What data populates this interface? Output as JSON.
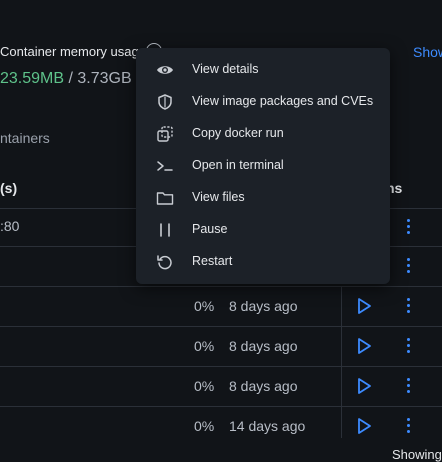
{
  "summary": {
    "memory_label": "Container memory usage",
    "memory_used": "23.59MB",
    "memory_separator": "/",
    "memory_total": "3.73GB",
    "show_link": "Show"
  },
  "tabs": {
    "containers": "ntainers"
  },
  "table": {
    "headers": {
      "ports": "(s)",
      "actions": "ns"
    },
    "rows": [
      {
        "port": ":80",
        "cpu": "",
        "last_started": ""
      },
      {
        "port": "",
        "cpu": "",
        "last_started": ""
      },
      {
        "port": "",
        "cpu": "0%",
        "last_started": "8 days ago"
      },
      {
        "port": "",
        "cpu": "0%",
        "last_started": "8 days ago"
      },
      {
        "port": "",
        "cpu": "0%",
        "last_started": "8 days ago"
      },
      {
        "port": "",
        "cpu": "0%",
        "last_started": "14 days ago"
      }
    ],
    "footer": "Showing"
  },
  "context_menu": {
    "items": [
      {
        "label": "View details",
        "icon": "eye-icon"
      },
      {
        "label": "View image packages and CVEs",
        "icon": "shield-icon"
      },
      {
        "label": "Copy docker run",
        "icon": "copy-icon"
      },
      {
        "label": "Open in terminal",
        "icon": "terminal-icon"
      },
      {
        "label": "View files",
        "icon": "folder-icon"
      },
      {
        "label": "Pause",
        "icon": "pause-icon"
      },
      {
        "label": "Restart",
        "icon": "restart-icon"
      }
    ]
  },
  "colors": {
    "accent": "#3d8bff",
    "memory_used": "#5ec28a",
    "background": "#111418",
    "menu_background": "#1c2128"
  }
}
